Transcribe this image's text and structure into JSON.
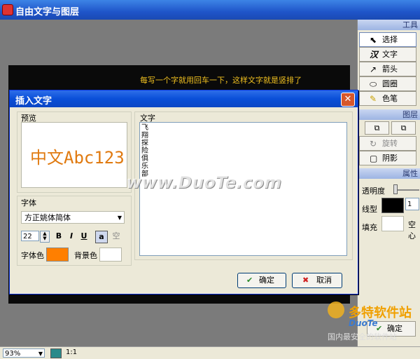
{
  "window": {
    "title": "自由文字与图层"
  },
  "canvas": {
    "caption": "每写一个字就用回车一下，这样文字就是竖排了"
  },
  "tools": {
    "section_title": "工具",
    "items": [
      {
        "label": "选择",
        "icon": "cursor-icon"
      },
      {
        "label": "文字",
        "icon": "text-tool-icon"
      },
      {
        "label": "箭头",
        "icon": "arrow-icon"
      },
      {
        "label": "圆圈",
        "icon": "ellipse-icon"
      },
      {
        "label": "色笔",
        "icon": "pen-icon"
      }
    ]
  },
  "layers": {
    "section_title": "图层",
    "rotate_label": "旋转",
    "shadow_label": "阴影"
  },
  "props": {
    "section_title": "属性",
    "opacity_label": "透明度",
    "linetype_label": "线型",
    "line_value": "1",
    "fill_label": "填充",
    "fill_value": "空心"
  },
  "dialog": {
    "title": "插入文字",
    "preview_label": "预览",
    "preview_text": "中文Abc123",
    "text_label": "文字",
    "text_value": "飞翔探险俱乐部",
    "font_label": "字体",
    "font_value": "方正姚体简体",
    "font_size": "22",
    "bold": "B",
    "italic": "I",
    "underline": "U",
    "outline": "a",
    "shadow": "空",
    "fg_label": "字体色",
    "bg_label": "背景色",
    "fg_color": "#ff7f00",
    "ok_label": "确定",
    "cancel_label": "取消"
  },
  "status": {
    "zoom": "93%",
    "ratio": "1:1"
  },
  "confirm_label": "确定",
  "watermark": "www.DuoTe.com",
  "logo": {
    "name": "多特软件站",
    "tagline": "国内最安全的软件站",
    "brand": "DuoTe"
  }
}
